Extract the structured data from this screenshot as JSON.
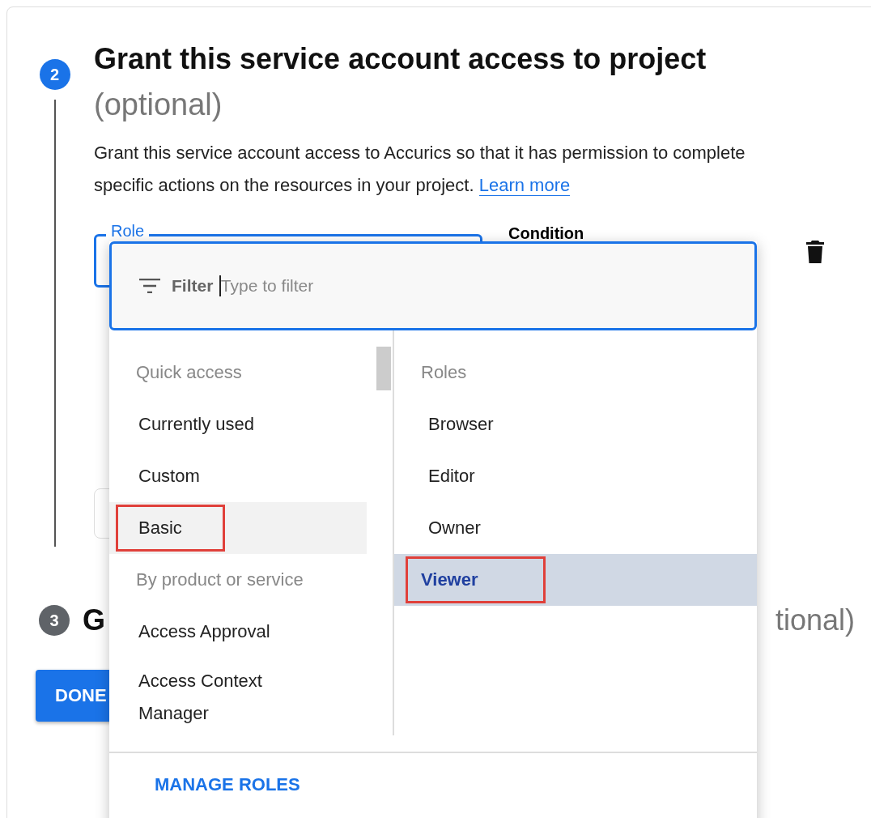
{
  "step2": {
    "number": "2",
    "title": "Grant this service account access to project",
    "optional": "(optional)",
    "description": "Grant this service account access to Accurics so that it has permission to complete specific actions on the resources in your project.",
    "link": "Learn more",
    "role_label": "Role",
    "condition_label": "Condition"
  },
  "step3": {
    "number": "3",
    "title_start": "G",
    "title_end": "tional)"
  },
  "done_button": "DONE",
  "role_menu": {
    "filter_label": "Filter",
    "filter_placeholder": "Type to filter",
    "categories": [
      {
        "kind": "header",
        "label": "Quick access"
      },
      {
        "kind": "item",
        "label": "Currently used",
        "hovered": false,
        "annotated": false
      },
      {
        "kind": "item",
        "label": "Custom",
        "hovered": false,
        "annotated": false
      },
      {
        "kind": "item",
        "label": "Basic",
        "hovered": true,
        "annotated": true
      },
      {
        "kind": "header",
        "label": "By product or service"
      },
      {
        "kind": "item",
        "label": "Access Approval",
        "hovered": false,
        "annotated": false
      },
      {
        "kind": "item",
        "label": "Access Context Manager",
        "hovered": false,
        "annotated": false
      }
    ],
    "roles": [
      {
        "kind": "header",
        "label": "Roles"
      },
      {
        "kind": "item",
        "label": "Browser",
        "selected": false,
        "annotated": false
      },
      {
        "kind": "item",
        "label": "Editor",
        "selected": false,
        "annotated": false
      },
      {
        "kind": "item",
        "label": "Owner",
        "selected": false,
        "annotated": false
      },
      {
        "kind": "item",
        "label": "Viewer",
        "selected": true,
        "annotated": true
      }
    ],
    "manage_button": "MANAGE ROLES"
  }
}
